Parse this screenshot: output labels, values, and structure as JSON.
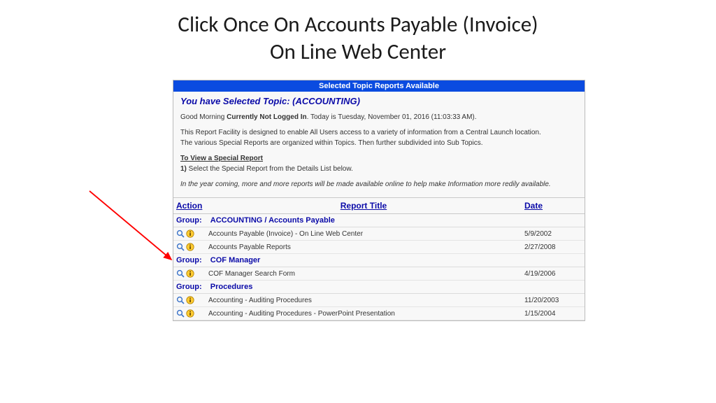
{
  "slide": {
    "title_line1": "Click Once On Accounts Payable (Invoice)",
    "title_line2": "On Line Web Center"
  },
  "panel": {
    "header": "Selected Topic Reports Available",
    "topic_prefix": "You have Selected Topic: ",
    "topic_value": "(ACCOUNTING)",
    "greeting_prefix": "Good Morning ",
    "login_status": "Currently Not Logged In",
    "greeting_suffix": ". Today is Tuesday, November 01, 2016 (11:03:33 AM).",
    "desc1": "This Report Facility is designed to enable All Users access to a variety of information from a Central Launch location.",
    "desc2": "The various Special Reports are organized within Topics. Then further subdivided into Sub Topics.",
    "howto_title": "To View a Special Report",
    "howto_step_num": "1)",
    "howto_step_text": " Select the Special Report from the Details List below.",
    "footnote": "In the year coming, more and more reports will be made available online to help make Information more redily available."
  },
  "table": {
    "columns": {
      "action": "Action",
      "title": "Report Title",
      "date": "Date"
    },
    "group_label": "Group:",
    "groups": [
      {
        "name": "ACCOUNTING / Accounts Payable",
        "rows": [
          {
            "title": "Accounts Payable (Invoice) - On Line Web Center",
            "date": "5/9/2002"
          },
          {
            "title": "Accounts Payable Reports",
            "date": "2/27/2008"
          }
        ]
      },
      {
        "name": "COF Manager",
        "rows": [
          {
            "title": "COF Manager Search Form",
            "date": "4/19/2006"
          }
        ]
      },
      {
        "name": "Procedures",
        "rows": [
          {
            "title": "Accounting - Auditing Procedures",
            "date": "11/20/2003"
          },
          {
            "title": "Accounting - Auditing Procedures - PowerPoint Presentation",
            "date": "1/15/2004"
          }
        ]
      }
    ]
  }
}
